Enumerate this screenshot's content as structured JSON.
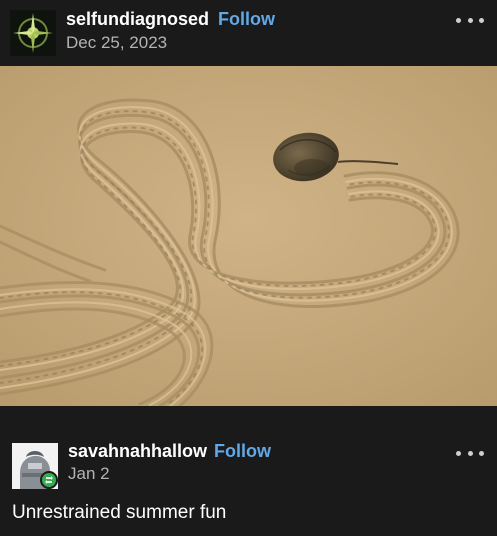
{
  "post": {
    "username": "selfundiagnosed",
    "follow_label": "Follow",
    "date": "Dec 25, 2023"
  },
  "reblog": {
    "username": "savahnahhallow",
    "follow_label": "Follow",
    "date": "Jan 2",
    "text": "Unrestrained summer fun"
  },
  "icons": {
    "more_menu": "more-horizontal-icon",
    "reblog_badge": "reblog-icon"
  },
  "colors": {
    "background": "#1a1a1a",
    "follow": "#5fa9e8",
    "reblog_badge": "#2bb24c",
    "sand": "#c8ad80"
  }
}
